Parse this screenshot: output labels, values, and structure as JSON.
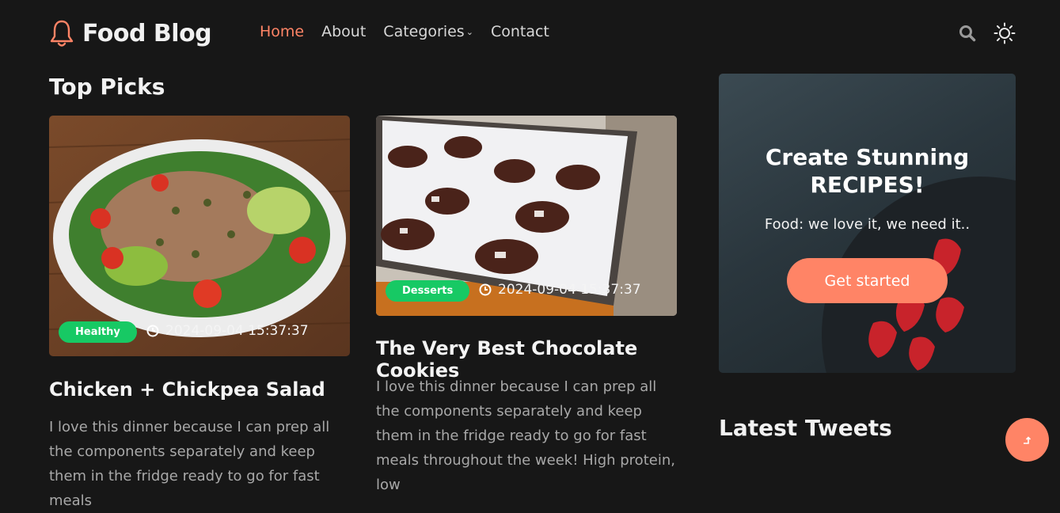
{
  "header": {
    "logo_text": "Food Blog",
    "nav": [
      "Home",
      "About",
      "Categories",
      "Contact"
    ],
    "active_nav": "Home"
  },
  "top_picks": {
    "title": "Top Picks",
    "posts": [
      {
        "category": "Healthy",
        "date": "2024-09-04 15:37:37",
        "title": "Chicken + Chickpea Salad",
        "excerpt": "I love this dinner because I can prep all the components separately and keep them in the fridge ready to go for fast meals"
      },
      {
        "category": "Desserts",
        "date": "2024-09-04 15:37:37",
        "title": "The Very Best Chocolate Cookies",
        "excerpt": "I love this dinner because I can prep all the components separately and keep them in the fridge ready to go for fast meals throughout the week! High protein, low"
      }
    ]
  },
  "promo": {
    "title": "Create Stunning RECIPES!",
    "subtitle": "Food: we love it, we need it..",
    "button": "Get started"
  },
  "sidebar": {
    "tweets_title": "Latest Tweets"
  },
  "colors": {
    "accent": "#ff8466",
    "badge": "#17c964",
    "background": "#171717"
  }
}
